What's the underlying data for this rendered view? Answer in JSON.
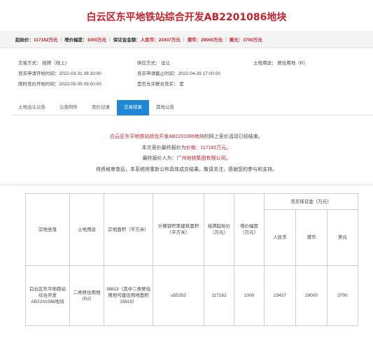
{
  "title": "白云区东平地铁站综合开发AB2201086地块",
  "price_bar": [
    {
      "label": "起始价：",
      "value": "117182万元"
    },
    {
      "label": "增价幅度：",
      "value": "1000万元"
    },
    {
      "label": "保证金金额：",
      "value": "人民币：23437万元"
    },
    {
      "label": "",
      "value": "港币：29000万元"
    },
    {
      "label": "",
      "value": "美元：3700万元"
    }
  ],
  "info": {
    "trade_mode": "交易方式：  挂牌（线上）",
    "supply_mode": "供应方式：  出让",
    "land_use": "土地用途：  居住用地（R）",
    "bid_start": "竞买申请开始时间：2022-03-31 08:30:00",
    "bid_end": "竞买申请截止时间：2022-04-29 17:00:00",
    "limit_start": "限时竞价开始时间：2022-05-05 09:00:00",
    "joint_bid": "是否允许联合竞买：  是"
  },
  "tabs": [
    "土地出让公告",
    "公告附件",
    "竞价记录",
    "交易结果",
    "其他公告"
  ],
  "notice": {
    "line1_parcel": "白云区东平地铁站综合开发AB2201086地块",
    "line1_suffix": "的网上竞价活动已经结束。",
    "line2_prefix": "本次竞价最终报价为",
    "line2_price": "价格：117182万元。",
    "line3_prefix": "最终报价人为：",
    "line3_winner": "广州地铁集团有限公司。",
    "line4": "待资格审查后，本系统将重新公布具体成交结果，敬请关注，感谢您的参与和支持。"
  },
  "table": {
    "headers": {
      "location": "宗地坐落",
      "land_use": "土地用途",
      "area": "宗地面积（平方米）",
      "building_area": "计算容积率建筑面积（平方米）",
      "start_price": "挂牌起始价（万元）",
      "increment": "增价幅度（万元）",
      "deposit": "竞买保证金（万元）",
      "rmb": "人民币",
      "hkd": "港币",
      "usd": "美元"
    },
    "row": {
      "location": "白云区东平地铁站综合开发AB2201086地块",
      "land_use": "二类居住用地（R2）",
      "area": "38823（其中二类居住用地可建设用地面积15618）",
      "building_area": "≤55353",
      "start_price": "117182",
      "increment": "1000",
      "rmb": "23437",
      "hkd": "29000",
      "usd": "3700"
    }
  },
  "colors": {
    "accent_red": "#c8202a",
    "tab_blue": "#1e88d7"
  }
}
